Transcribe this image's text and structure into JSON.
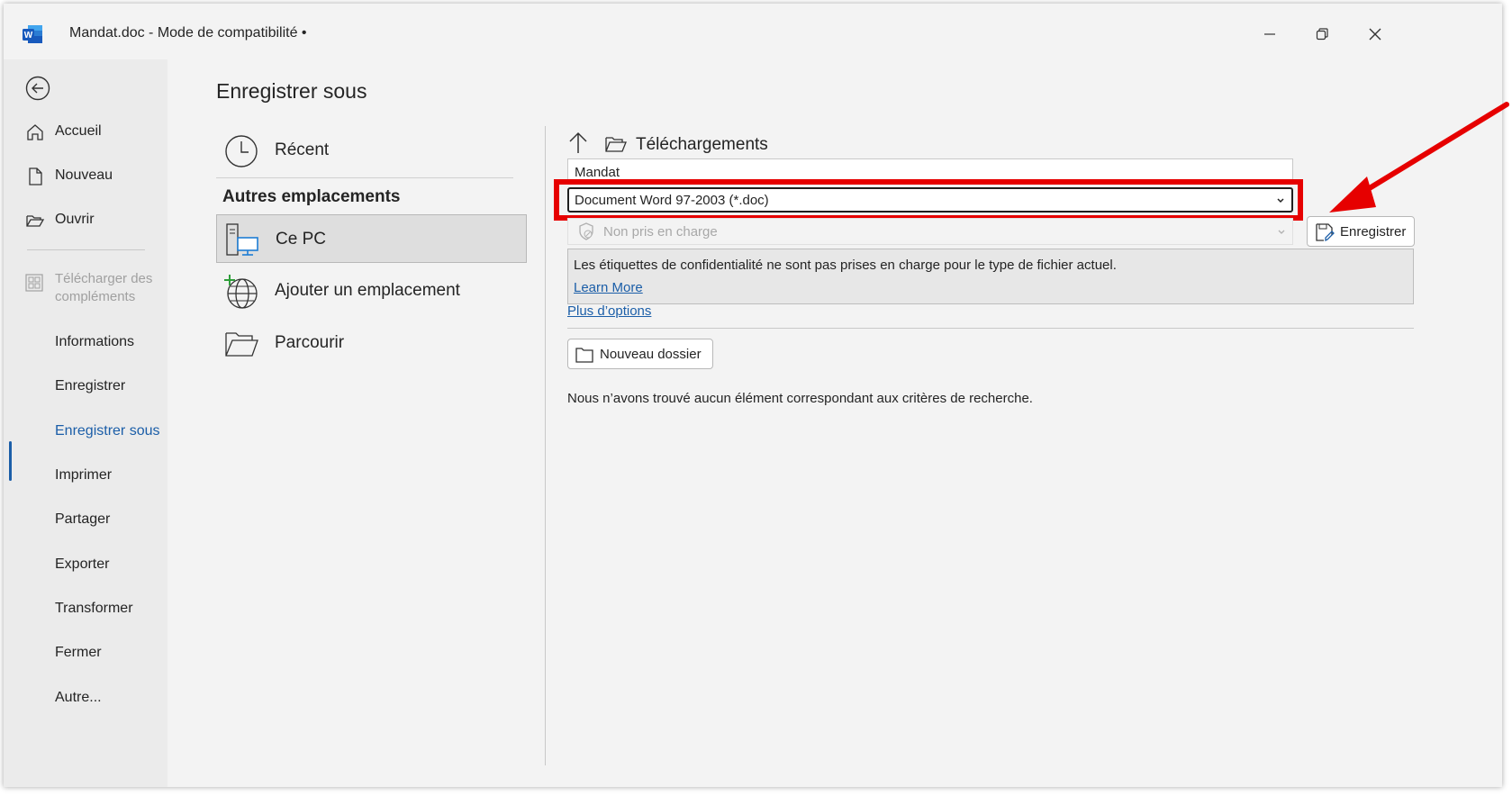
{
  "window": {
    "title": "Mandat.doc  -  Mode de compatibilité •",
    "app_icon": "word-icon",
    "controls": [
      "minimize-icon",
      "restore-icon",
      "close-icon"
    ]
  },
  "sidebar": {
    "back_icon": "back-arrow-icon",
    "items": [
      {
        "label": "Accueil",
        "icon": "home-icon"
      },
      {
        "label": "Nouveau",
        "icon": "new-document-icon"
      },
      {
        "label": "Ouvrir",
        "icon": "open-folder-icon"
      }
    ],
    "addins": {
      "label": "Télécharger des compléments",
      "icon": "addins-grid-icon",
      "disabled": true
    },
    "items2": [
      {
        "label": "Informations"
      },
      {
        "label": "Enregistrer"
      },
      {
        "label": "Enregistrer sous",
        "active": true
      },
      {
        "label": "Imprimer"
      },
      {
        "label": "Partager"
      },
      {
        "label": "Exporter"
      },
      {
        "label": "Transformer"
      },
      {
        "label": "Fermer"
      },
      {
        "label": "Autre..."
      }
    ]
  },
  "main": {
    "title": "Enregistrer sous",
    "recent": {
      "label": "Récent",
      "icon": "clock-icon"
    },
    "other_locations_heading": "Autres emplacements",
    "locations": [
      {
        "label": "Ce PC",
        "icon": "pc-icon",
        "selected": true
      },
      {
        "label": "Ajouter un emplacement",
        "icon": "globe-add-icon"
      },
      {
        "label": "Parcourir",
        "icon": "folder-open-icon"
      }
    ]
  },
  "save_panel": {
    "path": "Téléchargements",
    "filename": "Mandat",
    "file_type": "Document Word 97-2003 (*.doc)",
    "sensitivity": "Non pris en charge",
    "save_button": "Enregistrer",
    "info_message": "Les étiquettes de confidentialité ne sont pas prises en charge pour le type de fichier actuel.",
    "learn_more": "Learn More",
    "more_options": "Plus d’options",
    "new_folder": "Nouveau dossier",
    "empty_message": "Nous n’avons trouvé aucun élément correspondant aux critères de recherche."
  },
  "annotation": {
    "color": "#e60000"
  },
  "colors": {
    "accent": "#1b5ea8",
    "highlight": "#e60000",
    "word_blue": "#185abd"
  }
}
